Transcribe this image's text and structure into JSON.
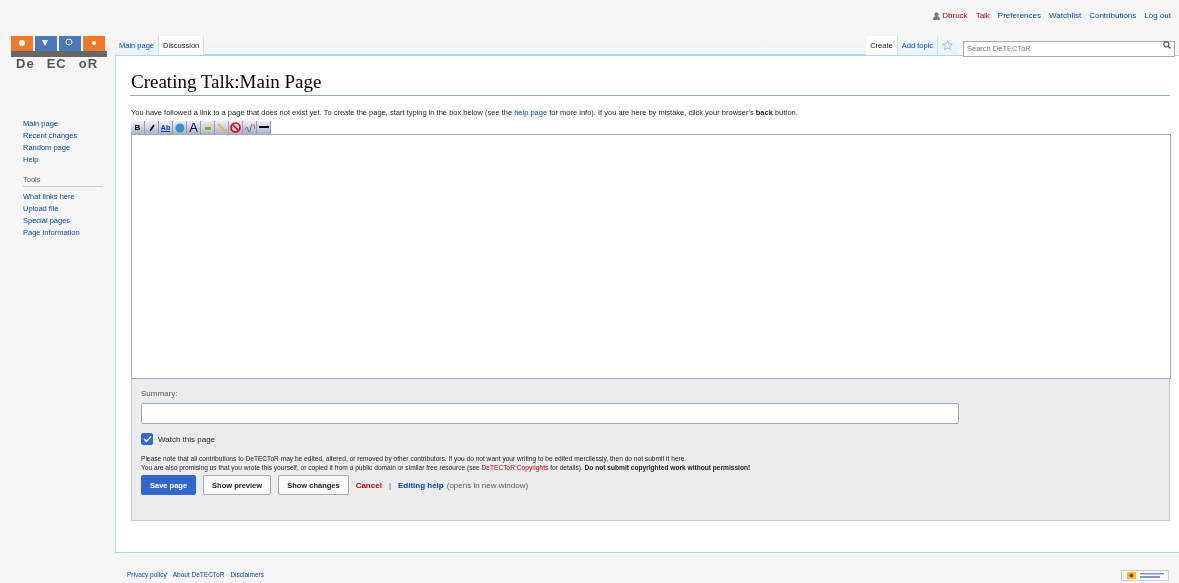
{
  "personal_tools": [
    {
      "label": "Dbruck",
      "kind": "user",
      "missing": true
    },
    {
      "label": "Talk",
      "kind": "link",
      "missing": true
    },
    {
      "label": "Preferences",
      "kind": "link",
      "missing": false
    },
    {
      "label": "Watchlist",
      "kind": "link",
      "missing": false
    },
    {
      "label": "Contributions",
      "kind": "link",
      "missing": false
    },
    {
      "label": "Log out",
      "kind": "link",
      "missing": false
    }
  ],
  "logo": {
    "parts": [
      "De",
      "EC",
      "oR"
    ]
  },
  "sidebar": {
    "navigation": [
      {
        "label": "Main page"
      },
      {
        "label": "Recent changes"
      },
      {
        "label": "Random page"
      },
      {
        "label": "Help"
      }
    ],
    "tools_heading": "Tools",
    "tools": [
      {
        "label": "What links here"
      },
      {
        "label": "Upload file"
      },
      {
        "label": "Special pages"
      },
      {
        "label": "Page information"
      }
    ]
  },
  "namespace_tabs": [
    {
      "label": "Main page",
      "selected": false
    },
    {
      "label": "Discussion",
      "selected": true
    }
  ],
  "view_tabs": [
    {
      "label": "Create",
      "selected": true
    },
    {
      "label": "Add topic",
      "selected": false
    }
  ],
  "watch_star": {
    "on": false
  },
  "search": {
    "placeholder": "Search DeTECToR"
  },
  "title": "Creating Talk:Main Page",
  "intro": {
    "before": "You have followed a link to a page that does not exist yet. To create the page, start typing in the box below (see the",
    "link": "help page",
    "after": "for more info). If you are here by mistake, click your browser's **back** button."
  },
  "toolbar": [
    {
      "kind": "bold",
      "label": "B"
    },
    {
      "kind": "italic"
    },
    {
      "kind": "link",
      "label": "Ab"
    },
    {
      "kind": "globe"
    },
    {
      "kind": "headline",
      "label": "A"
    },
    {
      "kind": "image"
    },
    {
      "kind": "media"
    },
    {
      "kind": "nowiki"
    },
    {
      "kind": "signature"
    },
    {
      "kind": "rule"
    }
  ],
  "summary": {
    "label": "Summary:"
  },
  "watch": {
    "label": "Watch this page",
    "checked": true
  },
  "notice": {
    "line1": "Please note that all contributions to DeTECToR may be edited, altered, or removed by other contributors. If you do not want your writing to be edited mercilessly, then do not submit it here.",
    "line2_before": "You are also promising us that you wrote this yourself, or copied it from a public domain or similar free resource (see",
    "line2_link": "DeTECToR:Copyrights",
    "line2_after": "for details). **Do not submit copyrighted work without permission!**"
  },
  "buttons": [
    {
      "label": "Save page",
      "kind": "primary"
    },
    {
      "label": "Show preview",
      "kind": "normal"
    },
    {
      "label": "Show changes",
      "kind": "normal"
    }
  ],
  "cancel": "Cancel",
  "separator": "|",
  "editing_help": "Editing help",
  "editing_help_note": "(opens in new window)",
  "footer": [
    {
      "label": "Privacy policy"
    },
    {
      "label": "About DeTECToR"
    },
    {
      "label": "Disclaimers"
    }
  ]
}
